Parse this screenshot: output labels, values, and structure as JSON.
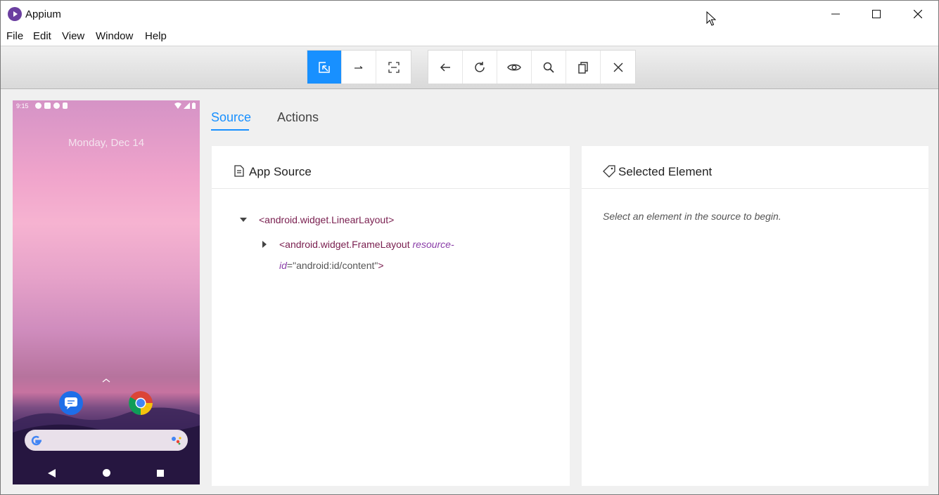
{
  "window": {
    "title": "Appium",
    "icons": [
      "appium-logo-icon",
      "minimize-icon",
      "maximize-icon",
      "close-icon"
    ]
  },
  "menu": {
    "items": [
      "File",
      "Edit",
      "View",
      "Window",
      "Help"
    ]
  },
  "toolbar": {
    "mode_group": [
      "select-elements-icon",
      "swipe-by-coordinates-icon",
      "tap-by-coordinates-icon"
    ],
    "action_group": [
      "back-icon",
      "refresh-icon",
      "show-source-icon",
      "search-icon",
      "copy-xml-icon",
      "quit-session-icon"
    ],
    "active_button": "select-elements-icon",
    "accent_color": "#1890ff"
  },
  "device": {
    "status_time": "9:15",
    "date": "Monday, Dec 14"
  },
  "tabs": {
    "source": "Source",
    "actions": "Actions"
  },
  "source_panel": {
    "title": "App Source",
    "tree": {
      "root": "<android.widget.LinearLayout>",
      "child_tag_open": "<android.widget.FrameLayout ",
      "child_attr_name_a": "resource-",
      "child_attr_name_b": "id",
      "child_attr_eq": "=",
      "child_attr_value": "\"android:id/content\"",
      "child_tag_close": ">"
    }
  },
  "selected_panel": {
    "title": "Selected Element",
    "hint": "Select an element in the source to begin."
  }
}
